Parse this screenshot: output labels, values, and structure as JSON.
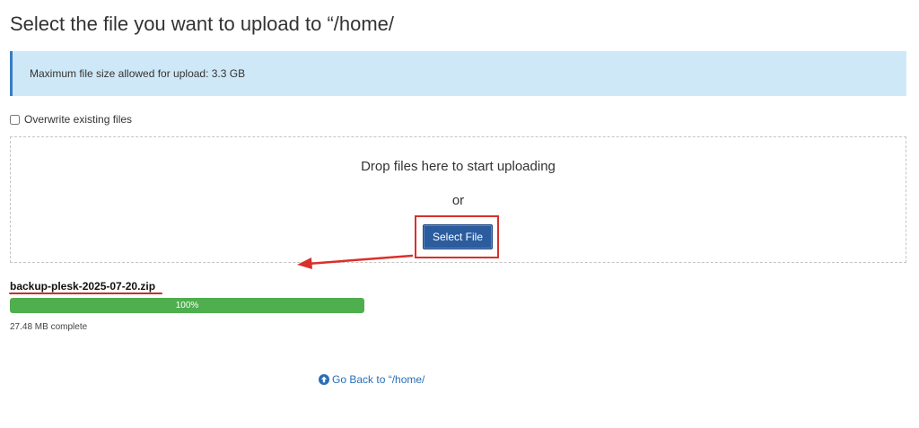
{
  "page": {
    "title": "Select the file you want to upload to “/home/"
  },
  "info": {
    "text": "Maximum file size allowed for upload: 3.3 GB",
    "accent_color": "#3a7cc2",
    "background_color": "#cfe8f7"
  },
  "options": {
    "overwrite_label": "Overwrite existing files",
    "overwrite_checked": false
  },
  "dropzone": {
    "drop_text": "Drop files here to start uploading",
    "or_text": "or",
    "select_button_label": "Select File",
    "button_color": "#2b5c9e",
    "highlight_color": "#d9302c"
  },
  "upload": {
    "file_name": "backup-plesk-2025-07-20.zip",
    "progress_percent": 100,
    "progress_label": "100%",
    "progress_color": "#4fae4e",
    "status_text": "27.48 MB complete"
  },
  "footer": {
    "back_link_label": "Go Back to “/home/",
    "back_icon": "circle-arrow-up-icon",
    "link_color": "#2a6fb5"
  }
}
